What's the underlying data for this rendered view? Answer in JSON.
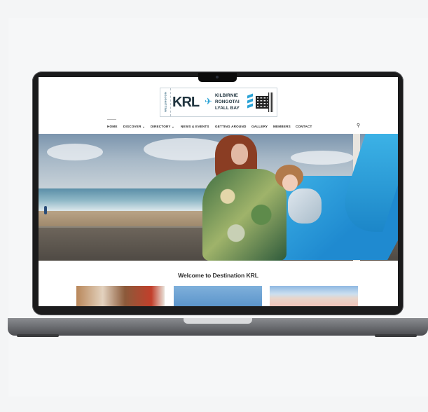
{
  "logo": {
    "stub_text": "WELLINGTON",
    "brand": "KRL",
    "plane_glyph": "✈",
    "places": [
      "KILBIRNIE",
      "RONGOTAI",
      "LYALL BAY"
    ],
    "qr_icon": "qr-code-icon"
  },
  "nav": {
    "items": [
      {
        "label": "HOME"
      },
      {
        "label": "DISCOVER ⌄"
      },
      {
        "label": "DIRECTORY ⌄"
      },
      {
        "label": "NEWS & EVENTS"
      },
      {
        "label": "GETTING AROUND"
      },
      {
        "label": "GALLERY"
      },
      {
        "label": "MEMBERS"
      },
      {
        "label": "CONTACT"
      }
    ],
    "search_icon": "search-icon",
    "search_glyph": "⚲"
  },
  "main": {
    "welcome_title": "Welcome to Destination KRL"
  },
  "colors": {
    "brand_blue": "#2ba3d6",
    "brand_dark": "#20343f"
  }
}
